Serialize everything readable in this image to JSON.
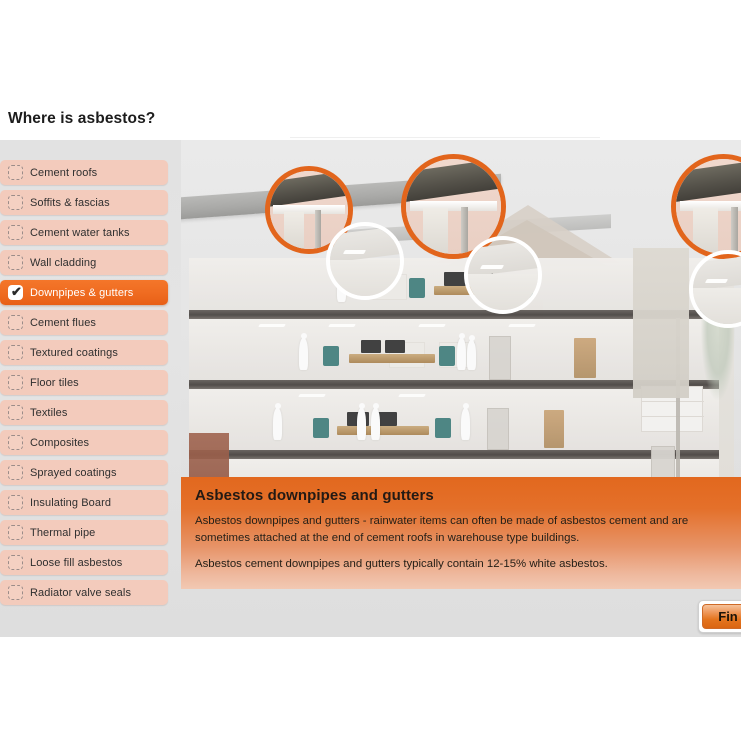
{
  "header": {
    "title": "Where is asbestos?"
  },
  "checklist": {
    "items": [
      {
        "label": "Cement roofs",
        "checked": false
      },
      {
        "label": "Soffits & fascias",
        "checked": false
      },
      {
        "label": "Cement water tanks",
        "checked": false
      },
      {
        "label": "Wall cladding",
        "checked": false
      },
      {
        "label": "Downpipes & gutters",
        "checked": true
      },
      {
        "label": "Cement flues",
        "checked": false
      },
      {
        "label": "Textured coatings",
        "checked": false
      },
      {
        "label": "Floor tiles",
        "checked": false
      },
      {
        "label": "Textiles",
        "checked": false
      },
      {
        "label": "Composites",
        "checked": false
      },
      {
        "label": "Sprayed coatings",
        "checked": false
      },
      {
        "label": "Insulating Board",
        "checked": false
      },
      {
        "label": "Thermal pipe",
        "checked": false
      },
      {
        "label": "Loose fill asbestos",
        "checked": false
      },
      {
        "label": "Radiator valve seals",
        "checked": false
      }
    ],
    "checkmark_glyph": "✔"
  },
  "illustration": {
    "alt": "cutaway-building-diagram",
    "hotspots": [
      {
        "name": "roof-gutter-detail-left",
        "style": "orange"
      },
      {
        "name": "ceiling-detail-left",
        "style": "white"
      },
      {
        "name": "roof-gutter-detail-center",
        "style": "orange"
      },
      {
        "name": "ceiling-detail-center",
        "style": "white"
      },
      {
        "name": "roof-gutter-detail-right",
        "style": "orange"
      },
      {
        "name": "ceiling-detail-right",
        "style": "white"
      }
    ]
  },
  "caption": {
    "heading": "Asbestos downpipes and gutters",
    "paragraph1": "Asbestos downpipes and gutters - rainwater items can often be made of asbestos cement and are sometimes attached at the end of cement roofs in warehouse type buildings.",
    "paragraph2": "Asbestos cement downpipes and gutters typically contain 12-15% white asbestos."
  },
  "footer": {
    "finish_button_label": "Fin"
  },
  "colors": {
    "accent_orange": "#e2681e",
    "item_peach": "#f3cbbc",
    "selected_orange": "#ef6b20",
    "shell_grey": "#e2e2e2",
    "title_dark": "#1c1c1c"
  }
}
